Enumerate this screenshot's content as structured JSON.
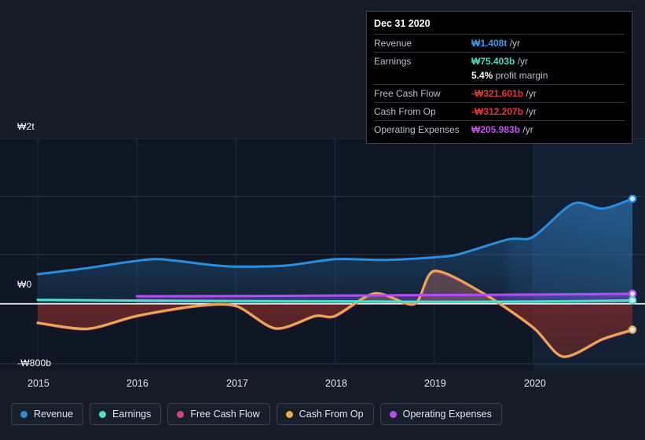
{
  "theme": {
    "background": "#151c26",
    "plot_background": "#101724",
    "forecast_background": "#0e1520",
    "grid": "#2e3643",
    "zero_line": "#ffffff",
    "axis_text": "#e8ecf2"
  },
  "tooltip": {
    "date": "Dec 31 2020",
    "rows": [
      {
        "label": "Revenue",
        "value": "₩1.408t",
        "suffix": "/yr",
        "color": "#3b9ae8"
      },
      {
        "label": "Earnings",
        "value": "₩75.403b",
        "suffix": "/yr",
        "color": "#4fd8bd"
      },
      {
        "label": "Free Cash Flow",
        "value": "-₩321.601b",
        "suffix": "/yr",
        "color": "#e53935"
      },
      {
        "label": "Cash From Op",
        "value": "-₩312.207b",
        "suffix": "/yr",
        "color": "#e53935"
      },
      {
        "label": "Operating Expenses",
        "value": "₩205.983b",
        "suffix": "/yr",
        "color": "#c050f0"
      }
    ],
    "profit_margin": {
      "value": "5.4%",
      "label": "profit margin"
    }
  },
  "legend": {
    "items": [
      {
        "label": "Revenue",
        "color": "#2b8ddd"
      },
      {
        "label": "Earnings",
        "color": "#4fe0c4"
      },
      {
        "label": "Free Cash Flow",
        "color": "#d6437b"
      },
      {
        "label": "Cash From Op",
        "color": "#e8a94f"
      },
      {
        "label": "Operating Expenses",
        "color": "#b34ef0"
      }
    ]
  },
  "chart_data": {
    "type": "area",
    "title": "",
    "xlabel": "",
    "ylabel": "",
    "grid": true,
    "legend_position": "bottom",
    "currency": "KRW",
    "y_ticks": [
      {
        "label": "₩2t",
        "value": 2000
      },
      {
        "label": "₩0",
        "value": 0
      },
      {
        "label": "-₩800b",
        "value": -800
      }
    ],
    "ylim": [
      -800,
      2000
    ],
    "x_ticks": [
      "2015",
      "2016",
      "2017",
      "2018",
      "2019",
      "2020"
    ],
    "xlim": [
      "2015",
      "2021"
    ],
    "forecast_starts": "2020",
    "unit_note": "values in billions KRW",
    "series": [
      {
        "name": "Revenue",
        "color": "#2b8ddd",
        "fill": true,
        "x": [
          "2015.00",
          "2015.50",
          "2016.00",
          "2016.25",
          "2016.75",
          "2017.00",
          "2017.50",
          "2018.00",
          "2018.50",
          "2019.00",
          "2019.25",
          "2019.75",
          "2020.00",
          "2020.40",
          "2020.70",
          "2021.00"
        ],
        "values": [
          358,
          432,
          520,
          538,
          470,
          450,
          462,
          540,
          530,
          562,
          600,
          780,
          810,
          1210,
          1150,
          1270
        ]
      },
      {
        "name": "Earnings",
        "color": "#4fe0c4",
        "fill": true,
        "x": [
          "2015.00",
          "2016.00",
          "2017.00",
          "2018.00",
          "2019.00",
          "2020.00",
          "2021.00"
        ],
        "values": [
          48,
          40,
          34,
          30,
          26,
          28,
          42
        ]
      },
      {
        "name": "Free Cash Flow",
        "color": "#d6437b",
        "fill": true,
        "x": [
          "2015.00",
          "2015.50",
          "2016.00",
          "2016.60",
          "2017.00",
          "2017.40",
          "2017.80",
          "2018.00",
          "2018.40",
          "2018.80",
          "2019.00",
          "2019.50",
          "2020.00",
          "2020.30",
          "2020.70",
          "2021.00"
        ],
        "values": [
          -232,
          -305,
          -150,
          -30,
          -28,
          -300,
          -150,
          -150,
          120,
          -5,
          390,
          120,
          -290,
          -640,
          -430,
          -322
        ]
      },
      {
        "name": "Cash From Op",
        "color": "#e8a94f",
        "fill": true,
        "x": [
          "2015.00",
          "2015.50",
          "2016.00",
          "2016.60",
          "2017.00",
          "2017.40",
          "2017.80",
          "2018.00",
          "2018.40",
          "2018.80",
          "2019.00",
          "2019.50",
          "2020.00",
          "2020.30",
          "2020.70",
          "2021.00"
        ],
        "values": [
          -228,
          -300,
          -145,
          -25,
          -25,
          -296,
          -145,
          -145,
          128,
          0,
          398,
          125,
          -285,
          -636,
          -425,
          -312
        ]
      },
      {
        "name": "Operating Expenses",
        "color": "#b34ef0",
        "fill": true,
        "x": [
          "2016.00",
          "2017.00",
          "2018.00",
          "2019.00",
          "2020.00",
          "2021.00"
        ],
        "values": [
          92,
          95,
          100,
          106,
          112,
          122
        ]
      }
    ]
  }
}
